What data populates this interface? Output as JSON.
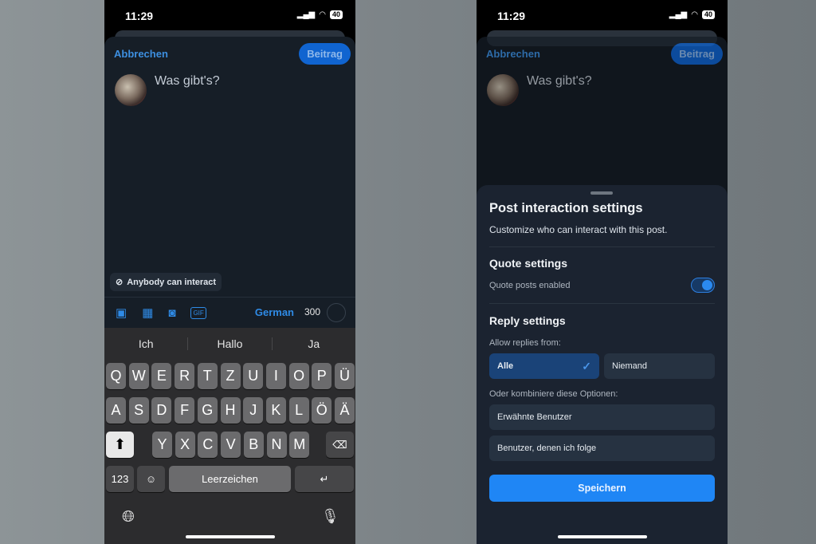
{
  "status": {
    "time": "11:29",
    "battery": "40"
  },
  "compose": {
    "cancel": "Abbrechen",
    "post": "Beitrag",
    "placeholder": "Was gibt's?",
    "interaction_chip": "Anybody can interact",
    "language": "German",
    "char_count": "300"
  },
  "keyboard": {
    "suggestions": [
      "Ich",
      "Hallo",
      "Ja"
    ],
    "rows": [
      [
        "Q",
        "W",
        "E",
        "R",
        "T",
        "Z",
        "U",
        "I",
        "O",
        "P",
        "Ü"
      ],
      [
        "A",
        "S",
        "D",
        "F",
        "G",
        "H",
        "J",
        "K",
        "L",
        "Ö",
        "Ä"
      ],
      [
        "Y",
        "X",
        "C",
        "V",
        "B",
        "N",
        "M"
      ]
    ],
    "numbers": "123",
    "space": "Leerzeichen"
  },
  "settings": {
    "title": "Post interaction settings",
    "subtitle": "Customize who can interact with this post.",
    "quote_title": "Quote settings",
    "quote_label": "Quote posts enabled",
    "quote_enabled": true,
    "reply_title": "Reply settings",
    "allow_label": "Allow replies from:",
    "option_all": "Alle",
    "option_none": "Niemand",
    "selected": "Alle",
    "combine_label": "Oder kombiniere diese Optionen:",
    "combine_options": [
      "Erwähnte Benutzer",
      "Benutzer, denen ich folge"
    ],
    "save": "Speichern"
  },
  "colors": {
    "accent": "#1f86f5",
    "sheet": "#1b2330",
    "background": "#161e27"
  }
}
